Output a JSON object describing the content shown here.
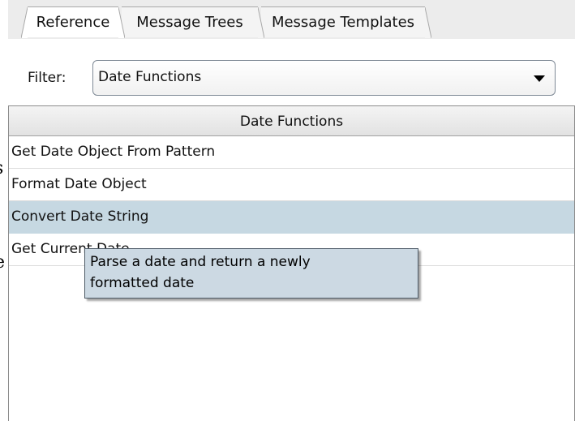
{
  "tabs": [
    {
      "label": "Reference",
      "active": true
    },
    {
      "label": "Message Trees",
      "active": false
    },
    {
      "label": "Message Templates",
      "active": false
    }
  ],
  "filter": {
    "label": "Filter:",
    "selected": "Date Functions"
  },
  "table": {
    "header": "Date Functions",
    "rows": [
      {
        "label": "Get Date Object From Pattern",
        "selected": false
      },
      {
        "label": "Format Date Object",
        "selected": false
      },
      {
        "label": "Convert Date String",
        "selected": true
      },
      {
        "label": "Get Current Date",
        "selected": false
      }
    ]
  },
  "tooltip": {
    "lines": [
      "Parse a date and return a newly",
      "formatted date"
    ]
  },
  "colors": {
    "selection": "#c6d8e2",
    "tooltip_bg": "#ccd9e3"
  }
}
